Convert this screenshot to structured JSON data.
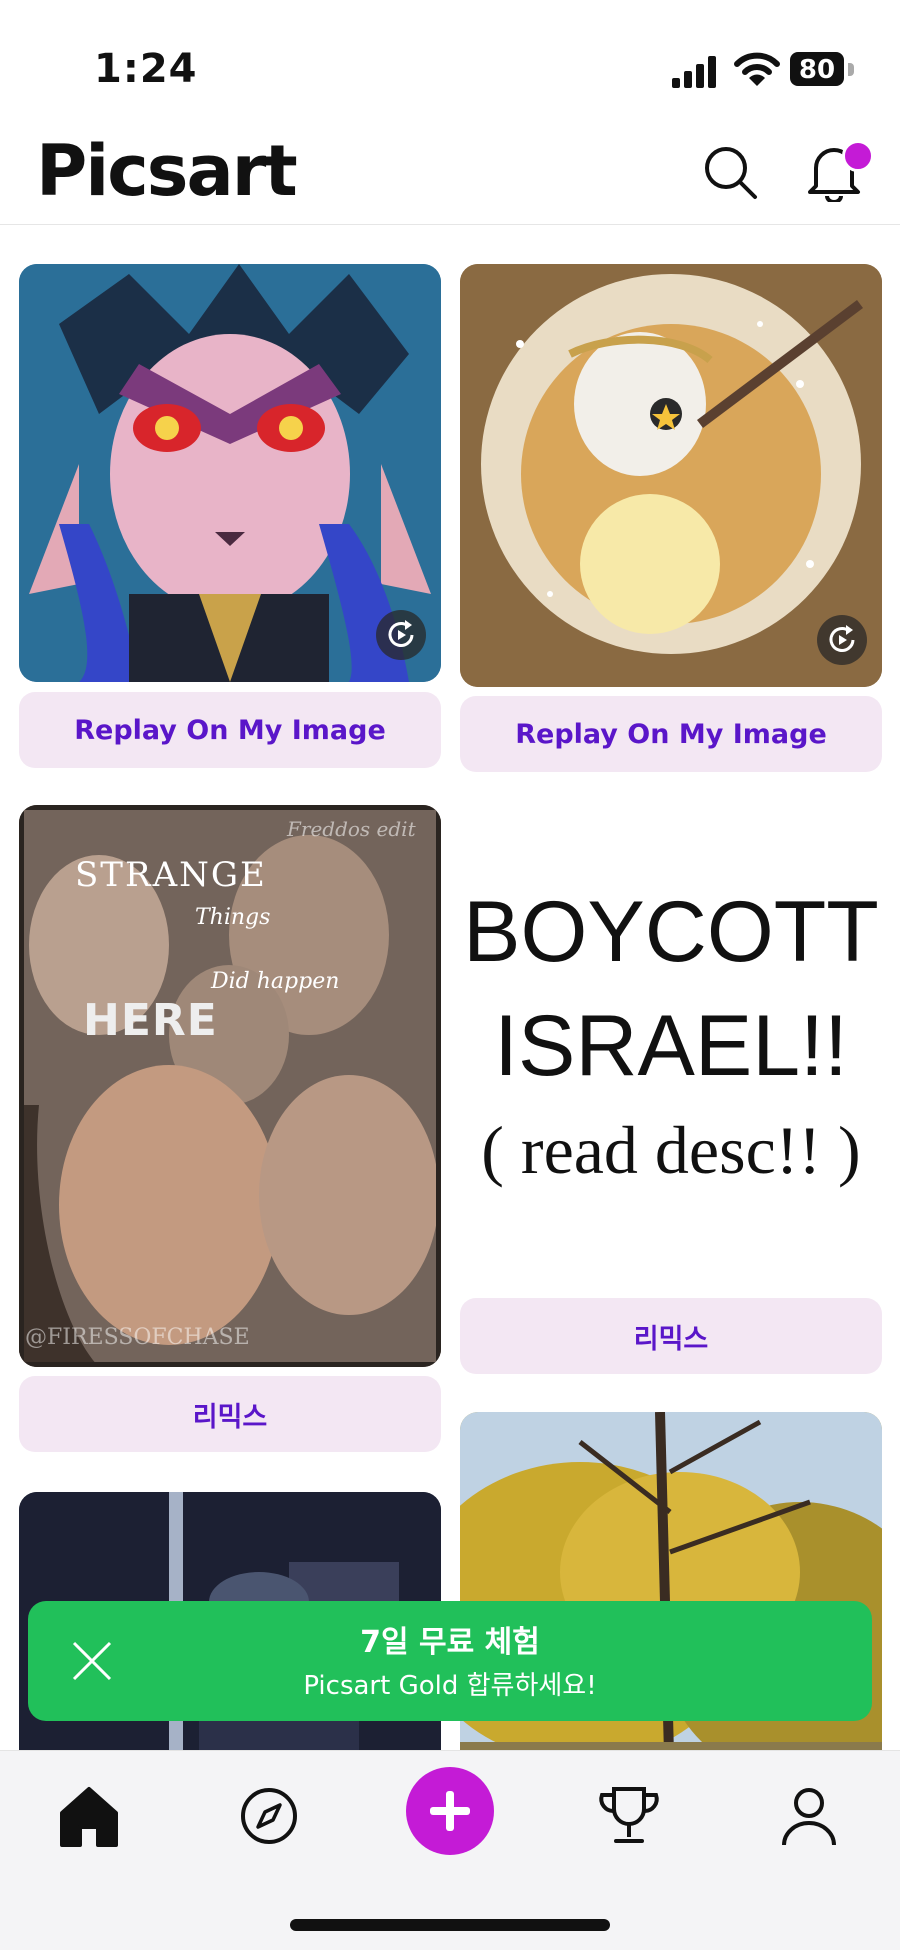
{
  "status_bar": {
    "time": "1:24",
    "battery": "80"
  },
  "header": {
    "logo": "Picsart"
  },
  "feed": {
    "cards": [
      {
        "button_label": "Replay On My Image"
      },
      {
        "button_label": "Replay On My Image"
      },
      {
        "button_label": "리믹스",
        "overlay_texts": [
          "STRANGE",
          "Things",
          "Did happen",
          "HERE",
          "Freddos edit",
          "@FIRESSOFCHASE"
        ]
      },
      {
        "button_label": "리믹스",
        "text_lines": [
          "BOYCOTT",
          "ISRAEL!!",
          "( read desc!! )"
        ]
      }
    ]
  },
  "promo": {
    "title": "7일 무료 체험",
    "subtitle": "Picsart Gold 합류하세요!"
  },
  "nav": {
    "items": [
      "home-icon",
      "explore-compass-icon",
      "create-plus-icon",
      "challenges-trophy-icon",
      "profile-icon"
    ]
  },
  "colors": {
    "accent": "#c41bd6",
    "pill_bg": "#f3e7f3",
    "pill_text": "#5a16c9",
    "promo_bg": "#21c05a"
  }
}
